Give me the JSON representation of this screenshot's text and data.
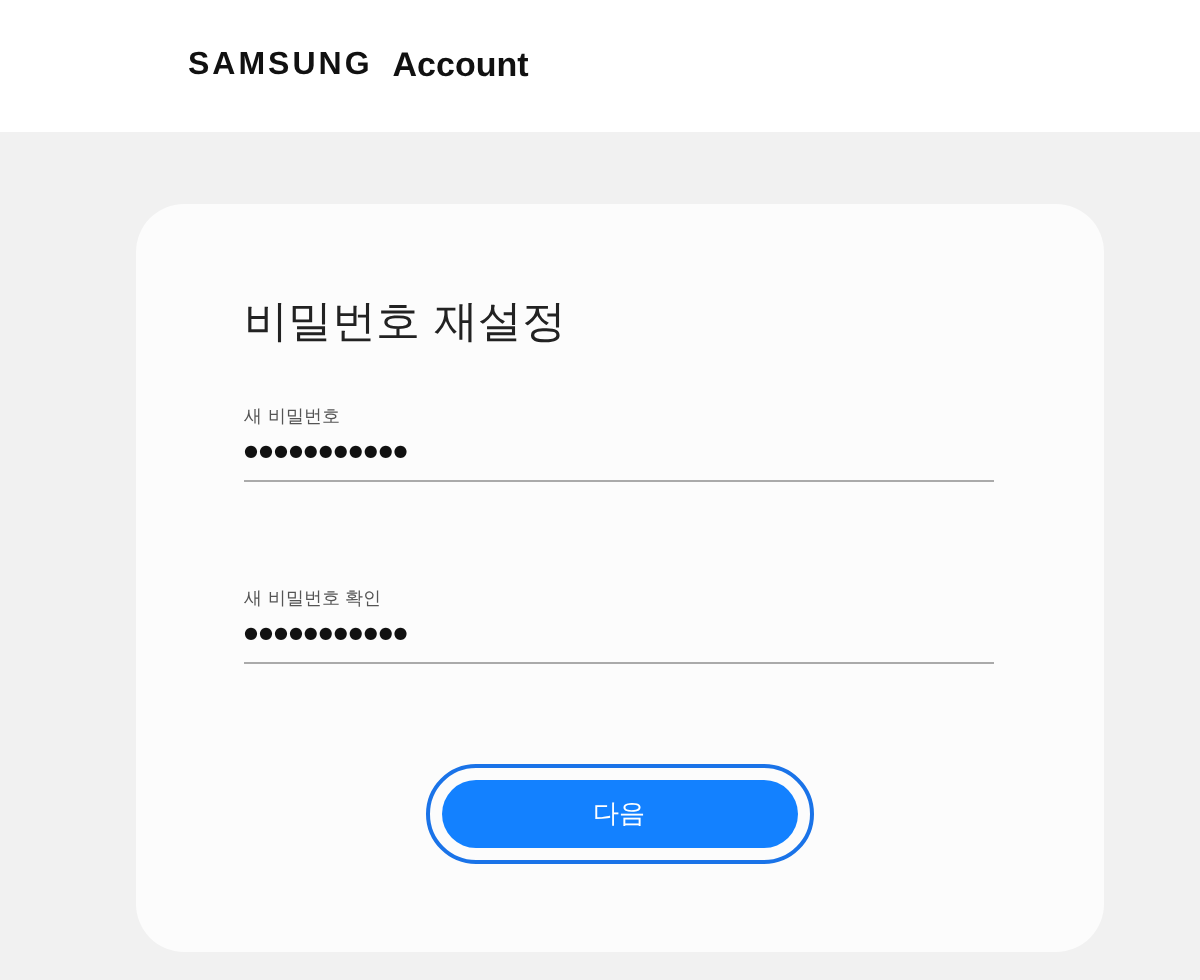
{
  "header": {
    "brand": "SAMSUNG",
    "product": "Account"
  },
  "card": {
    "title": "비밀번호 재설정",
    "fields": [
      {
        "label": "새 비밀번호",
        "value": "●●●●●●●●●●●"
      },
      {
        "label": "새 비밀번호 확인",
        "value": "●●●●●●●●●●●"
      }
    ],
    "button": {
      "label": "다음",
      "focused": true
    }
  }
}
